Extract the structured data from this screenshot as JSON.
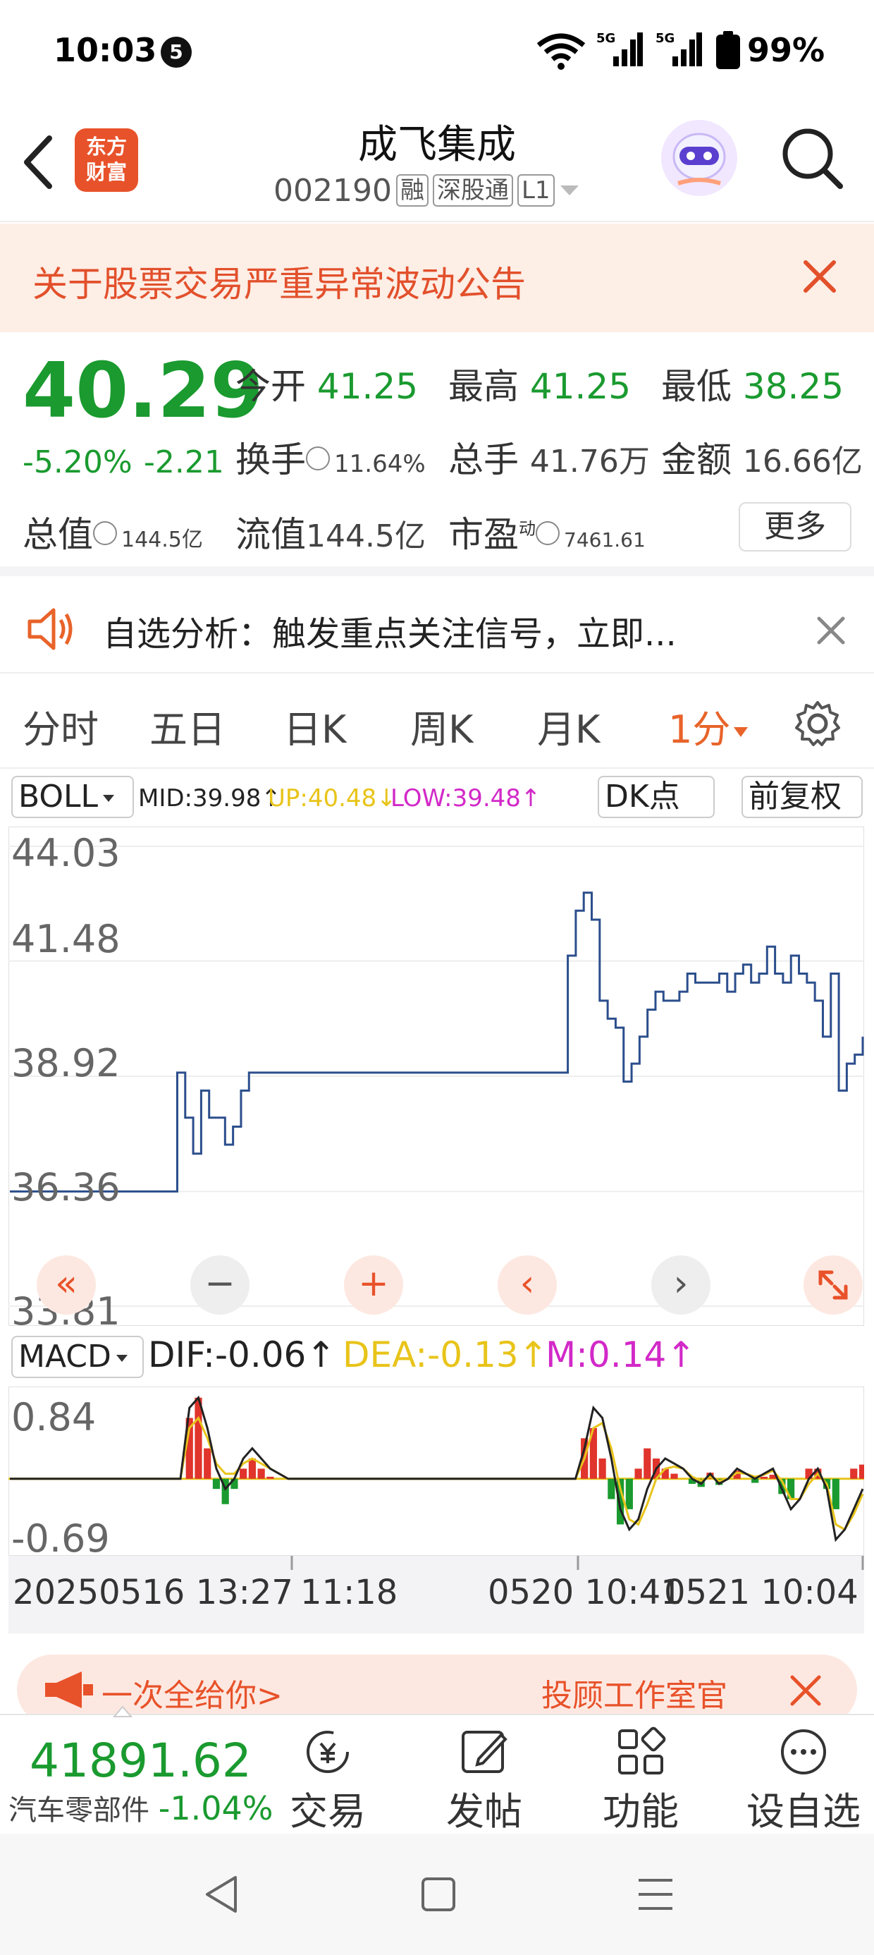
{
  "status": {
    "time": "10:03",
    "notif_count": "5",
    "battery": "99%",
    "network": "5G"
  },
  "nav": {
    "logo_text_1": "东方",
    "logo_text_2": "财富",
    "stock_name": "成飞集成",
    "stock_code": "002190",
    "tags": [
      "融",
      "深股通",
      "L1"
    ]
  },
  "banner": {
    "text": "关于股票交易严重异常波动公告"
  },
  "quote": {
    "price": "40.29",
    "change_pct": "-5.20%",
    "change_amt": "-2.21",
    "open_label": "今开",
    "open": "41.25",
    "high_label": "最高",
    "high": "41.25",
    "low_label": "最低",
    "low": "38.25",
    "turnover_label": "换手",
    "turnover": "11.64%",
    "volume_label": "总手",
    "volume": "41.76万",
    "amount_label": "金额",
    "amount": "16.66亿",
    "mktcap_label": "总值",
    "mktcap": "144.5亿",
    "float_label": "流值",
    "float_cap": "144.5亿",
    "pe_label": "市盈",
    "pe_sup": "动",
    "pe": "7461.61",
    "more_label": "更多"
  },
  "analysis": {
    "text": "自选分析：触发重点关注信号，立即..."
  },
  "tabs": {
    "items": [
      "分时",
      "五日",
      "日K",
      "周K",
      "月K"
    ],
    "active": "1分"
  },
  "chart_toolbar": {
    "indicator": "BOLL",
    "mid": "MID:39.98↑",
    "up": "UP:40.48↓",
    "low": "LOW:39.48↑",
    "dk": "DK点",
    "adjust": "前复权"
  },
  "macd": {
    "indicator": "MACD",
    "dif": "DIF:-0.06↑",
    "dea": "DEA:-0.13↑",
    "m": "M:0.14↑"
  },
  "time_axis": {
    "labels": [
      "20250516 13:27",
      "11:18",
      "0520 10:41",
      "0521 10:04"
    ]
  },
  "ad": {
    "left_text": "一次全给你>",
    "right_text": "投顾工作室官"
  },
  "bottom": {
    "index_value": "41891.62",
    "index_name": "汽车零部件",
    "index_change": "-1.04%",
    "buttons": [
      "交易",
      "发帖",
      "功能",
      "设自选"
    ]
  },
  "colors": {
    "up": "#e0342c",
    "down": "#1a9a2f",
    "accent": "#e8632a",
    "line": "#2b4e8c",
    "dea": "#e8c41a",
    "m": "#d229c8"
  },
  "chart_data": [
    {
      "type": "line",
      "title": "",
      "ylim": [
        33.81,
        44.03
      ],
      "y_ticks": [
        "44.03",
        "41.48",
        "38.92",
        "36.36",
        "33.81"
      ],
      "x_labels": [
        "20250516 13:27",
        "11:18",
        "0520 10:41",
        "0521 10:04"
      ],
      "series": [
        {
          "values": [
            36.36,
            36.36,
            36.36,
            36.36,
            36.36,
            36.36,
            36.36,
            36.36,
            36.36,
            36.36,
            36.36,
            36.36,
            36.36,
            36.36,
            36.36,
            36.36,
            36.36,
            36.36,
            36.36,
            36.36,
            36.36,
            39.0,
            38.0,
            37.2,
            38.6,
            38.0,
            38.0,
            37.4,
            37.8,
            38.6,
            39.0,
            39.0,
            39.0,
            39.0,
            39.0,
            39.0,
            39.0,
            39.0,
            39.0,
            39.0,
            39.0,
            39.0,
            39.0,
            39.0,
            39.0,
            39.0,
            39.0,
            39.0,
            39.0,
            39.0,
            39.0,
            39.0,
            39.0,
            39.0,
            39.0,
            39.0,
            39.0,
            39.0,
            39.0,
            39.0,
            39.0,
            39.0,
            39.0,
            39.0,
            39.0,
            39.0,
            39.0,
            39.0,
            39.0,
            39.0,
            41.6,
            42.6,
            43.0,
            42.4,
            40.6,
            40.2,
            40.0,
            38.8,
            39.2,
            39.8,
            40.4,
            40.8,
            40.6,
            40.6,
            40.8,
            41.2,
            41.0,
            41.0,
            41.0,
            41.2,
            40.8,
            41.2,
            41.4,
            41.0,
            41.2,
            41.8,
            41.2,
            41.0,
            41.6,
            41.2,
            41.0,
            40.6,
            39.8,
            41.2,
            38.6,
            39.2,
            39.4,
            39.8
          ]
        }
      ]
    },
    {
      "type": "bar",
      "title": "MACD",
      "ylim": [
        -0.69,
        0.84
      ],
      "y_ticks": [
        "0.84",
        "-0.69"
      ],
      "series": [
        {
          "name": "DIF",
          "values": [
            0,
            0,
            0,
            0,
            0,
            0,
            0,
            0,
            0,
            0,
            0,
            0,
            0,
            0,
            0,
            0,
            0,
            0,
            0,
            0,
            0.7,
            0.8,
            0.5,
            0.1,
            -0.1,
            0,
            0.2,
            0.3,
            0.2,
            0.1,
            0.05,
            0,
            0,
            0,
            0,
            0,
            0,
            0,
            0,
            0,
            0,
            0,
            0,
            0,
            0,
            0,
            0,
            0,
            0,
            0,
            0,
            0,
            0,
            0,
            0,
            0,
            0,
            0,
            0,
            0,
            0,
            0,
            0,
            0,
            0.3,
            0.7,
            0.6,
            0.2,
            -0.3,
            -0.5,
            -0.4,
            -0.1,
            0.1,
            0.2,
            0.15,
            0.1,
            0,
            -0.05,
            0.05,
            -0.05,
            0,
            0.1,
            0.05,
            0,
            0.05,
            0.1,
            -0.1,
            -0.3,
            -0.2,
            0.0,
            0.1,
            -0.1,
            -0.6,
            -0.5,
            -0.3,
            -0.1
          ]
        },
        {
          "name": "DEA",
          "values": [
            0,
            0,
            0,
            0,
            0,
            0,
            0,
            0,
            0,
            0,
            0,
            0,
            0,
            0,
            0,
            0,
            0,
            0,
            0,
            0,
            0.5,
            0.6,
            0.4,
            0.15,
            0.05,
            0.05,
            0.15,
            0.2,
            0.15,
            0.1,
            0.05,
            0,
            0,
            0,
            0,
            0,
            0,
            0,
            0,
            0,
            0,
            0,
            0,
            0,
            0,
            0,
            0,
            0,
            0,
            0,
            0,
            0,
            0,
            0,
            0,
            0,
            0,
            0,
            0,
            0,
            0,
            0,
            0,
            0,
            0.2,
            0.5,
            0.55,
            0.3,
            -0.1,
            -0.4,
            -0.45,
            -0.25,
            0,
            0.1,
            0.12,
            0.1,
            0.02,
            -0.02,
            0.02,
            -0.02,
            0,
            0.06,
            0.05,
            0.02,
            0.04,
            0.08,
            -0.02,
            -0.2,
            -0.2,
            -0.05,
            0.05,
            -0.05,
            -0.45,
            -0.5,
            -0.35,
            -0.15
          ]
        },
        {
          "name": "M",
          "values": [
            0,
            0,
            0,
            0,
            0,
            0,
            0,
            0,
            0,
            0,
            0,
            0,
            0,
            0,
            0,
            0,
            0,
            0,
            0,
            0,
            0.6,
            0.8,
            0.3,
            -0.1,
            -0.25,
            -0.1,
            0.1,
            0.2,
            0.1,
            0.02,
            0,
            0,
            0,
            0,
            0,
            0,
            0,
            0,
            0,
            0,
            0,
            0,
            0,
            0,
            0,
            0,
            0,
            0,
            0,
            0,
            0,
            0,
            0,
            0,
            0,
            0,
            0,
            0,
            0,
            0,
            0,
            0,
            0,
            0,
            0.4,
            0.5,
            0.2,
            -0.2,
            -0.45,
            -0.3,
            0.1,
            0.3,
            0.2,
            0.1,
            0.05,
            0,
            -0.05,
            -0.08,
            0.06,
            -0.06,
            0,
            0.08,
            0,
            -0.04,
            0.02,
            0.04,
            -0.15,
            -0.2,
            0,
            0.1,
            0.1,
            -0.1,
            -0.3,
            0,
            0.1,
            0.14
          ]
        }
      ]
    }
  ]
}
